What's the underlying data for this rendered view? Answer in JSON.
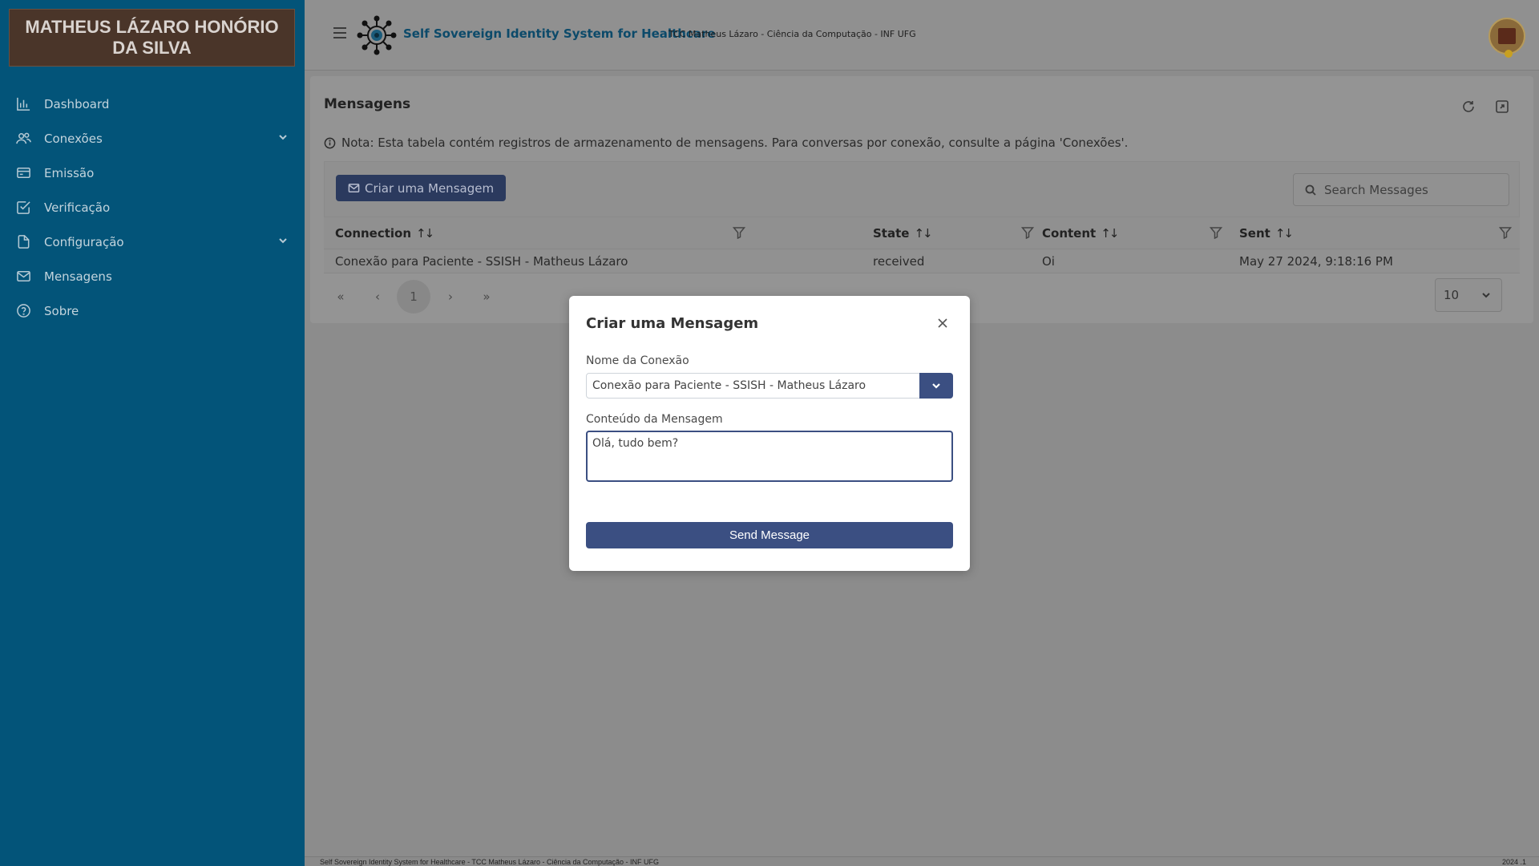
{
  "sidebar": {
    "brand": "MATHEUS LÁZARO HONÓRIO DA SILVA",
    "items": [
      {
        "label": "Dashboard",
        "icon": "chart-bar-icon"
      },
      {
        "label": "Conexões",
        "icon": "users-icon",
        "expandable": true
      },
      {
        "label": "Emissão",
        "icon": "credit-card-icon"
      },
      {
        "label": "Verificação",
        "icon": "check-square-icon"
      },
      {
        "label": "Configuração",
        "icon": "file-icon",
        "expandable": true
      },
      {
        "label": "Mensagens",
        "icon": "envelope-icon"
      },
      {
        "label": "Sobre",
        "icon": "question-circle-icon"
      }
    ]
  },
  "header": {
    "title": "Self Sovereign Identity System for Healthcare",
    "subtitle": "TCC Matheus Lázaro - Ciência da Computação - INF UFG"
  },
  "card": {
    "title": "Mensagens",
    "note": "Nota: Esta tabela contém registros de armazenamento de mensagens. Para conversas por conexão, consulte a página 'Conexões'.",
    "create_button": "Criar uma Mensagem",
    "search_placeholder": "Search Messages"
  },
  "table": {
    "columns": [
      "Connection",
      "State",
      "Content",
      "Sent"
    ],
    "rows": [
      [
        "Conexão para Paciente - SSISH - Matheus Lázaro",
        "received",
        "Oi",
        "May 27 2024, 9:18:16 PM"
      ]
    ]
  },
  "paginator": {
    "current_page": "1",
    "rows_per_page": "10"
  },
  "footer": {
    "left": "Self Sovereign Identity System for Healthcare - TCC Matheus Lázaro - Ciência da Computação - INF UFG",
    "right": "2024 .1"
  },
  "modal": {
    "title": "Criar uma Mensagem",
    "connection_label": "Nome da Conexão",
    "connection_value": "Conexão para Paciente - SSISH - Matheus Lázaro",
    "content_label": "Conteúdo da Mensagem",
    "content_value": "Olá, tudo bem?",
    "send_button": "Send Message"
  },
  "colors": {
    "sidebar": "#035479",
    "brand_box": "#4a3529",
    "primary": "#3b4f82",
    "overlay": "#8c8c8c"
  }
}
